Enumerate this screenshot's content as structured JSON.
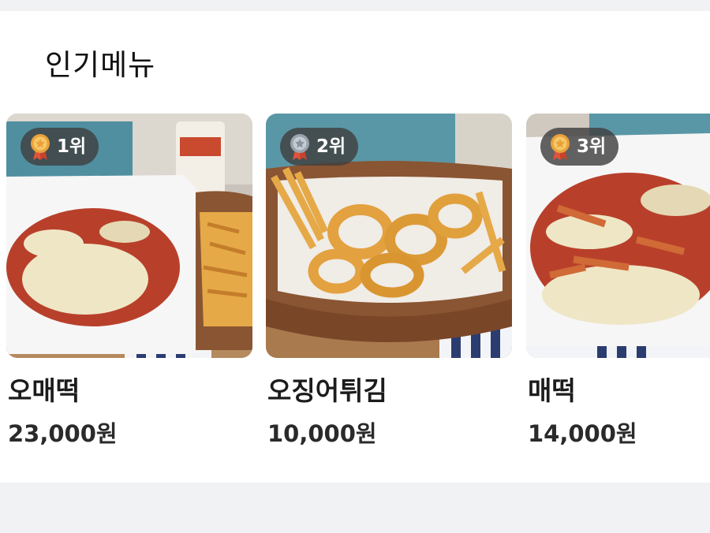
{
  "section": {
    "title": "인기메뉴"
  },
  "items": [
    {
      "rank": "1위",
      "medal": "gold-medal-icon",
      "name": "오매떡",
      "price": "23,000원",
      "image": "rabokki-with-cheese-and-fries-photo"
    },
    {
      "rank": "2위",
      "medal": "silver-medal-icon",
      "name": "오징어튀김",
      "price": "10,000원",
      "image": "fried-squid-basket-photo"
    },
    {
      "rank": "3위",
      "medal": "bronze-medal-icon",
      "name": "매떡",
      "price": "14,000원",
      "image": "spicy-tteokbokki-with-cheese-photo"
    }
  ],
  "colors": {
    "page_bg": "#f1f2f4",
    "card_bg": "#ffffff",
    "badge_bg": "#404040",
    "medal_gold": "#e9a23b",
    "medal_silver": "#9aa3ad",
    "medal_ribbon": "#e0533a"
  }
}
